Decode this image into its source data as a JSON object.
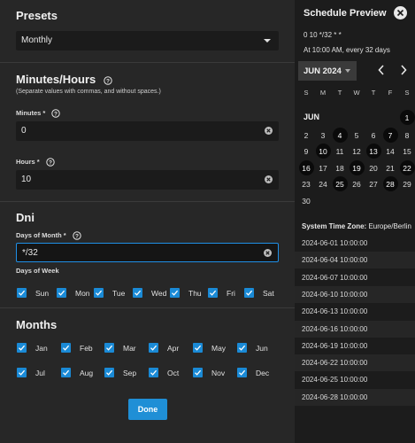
{
  "left": {
    "presets_title": "Presets",
    "preset_value": "Monthly",
    "minutes_hours_title": "Minutes/Hours",
    "separator_note": "(Separate values with commas, and without spaces.)",
    "minutes_label": "Minutes *",
    "minutes_value": "0",
    "hours_label": "Hours *",
    "hours_value": "10",
    "dni_title": "Dni",
    "days_of_month_label": "Days of Month *",
    "days_of_month_value": "*/32",
    "days_of_week_label": "Days of Week",
    "days_of_week": [
      "Sun",
      "Mon",
      "Tue",
      "Wed",
      "Thu",
      "Fri",
      "Sat"
    ],
    "months_title": "Months",
    "months": [
      "Jan",
      "Feb",
      "Mar",
      "Apr",
      "May",
      "Jun",
      "Jul",
      "Aug",
      "Sep",
      "Oct",
      "Nov",
      "Dec"
    ],
    "done_label": "Done"
  },
  "right": {
    "title": "Schedule Preview",
    "cron_expression": "0 10 */32 * *",
    "cron_description": "At 10:00 AM, every 32 days",
    "month_selector": "JUN 2024",
    "weekday_headers": [
      "S",
      "M",
      "T",
      "W",
      "T",
      "F",
      "S"
    ],
    "calendar_month_label": "JUN",
    "calendar_days": [
      "1",
      "2",
      "3",
      "4",
      "5",
      "6",
      "7",
      "8",
      "9",
      "10",
      "11",
      "12",
      "13",
      "14",
      "15",
      "16",
      "17",
      "18",
      "19",
      "20",
      "21",
      "22",
      "23",
      "24",
      "25",
      "26",
      "27",
      "28",
      "29",
      "30"
    ],
    "highlighted_days": [
      "1",
      "4",
      "7",
      "10",
      "13",
      "16",
      "19",
      "22",
      "25",
      "28"
    ],
    "tz_label": "System Time Zone:",
    "tz_value": "Europe/Berlin",
    "runs": [
      "2024-06-01 10:00:00",
      "2024-06-04 10:00:00",
      "2024-06-07 10:00:00",
      "2024-06-10 10:00:00",
      "2024-06-13 10:00:00",
      "2024-06-16 10:00:00",
      "2024-06-19 10:00:00",
      "2024-06-22 10:00:00",
      "2024-06-25 10:00:00",
      "2024-06-28 10:00:00"
    ]
  },
  "colors": {
    "accent": "#1f8fd6",
    "panel_left": "#272727",
    "panel_right": "#1c1c1c"
  },
  "icons": {
    "help": "help-circle-icon",
    "clear": "clear-circle-icon",
    "close": "close-icon",
    "prev": "chevron-left-icon",
    "next": "chevron-right-icon",
    "check": "check-icon"
  }
}
